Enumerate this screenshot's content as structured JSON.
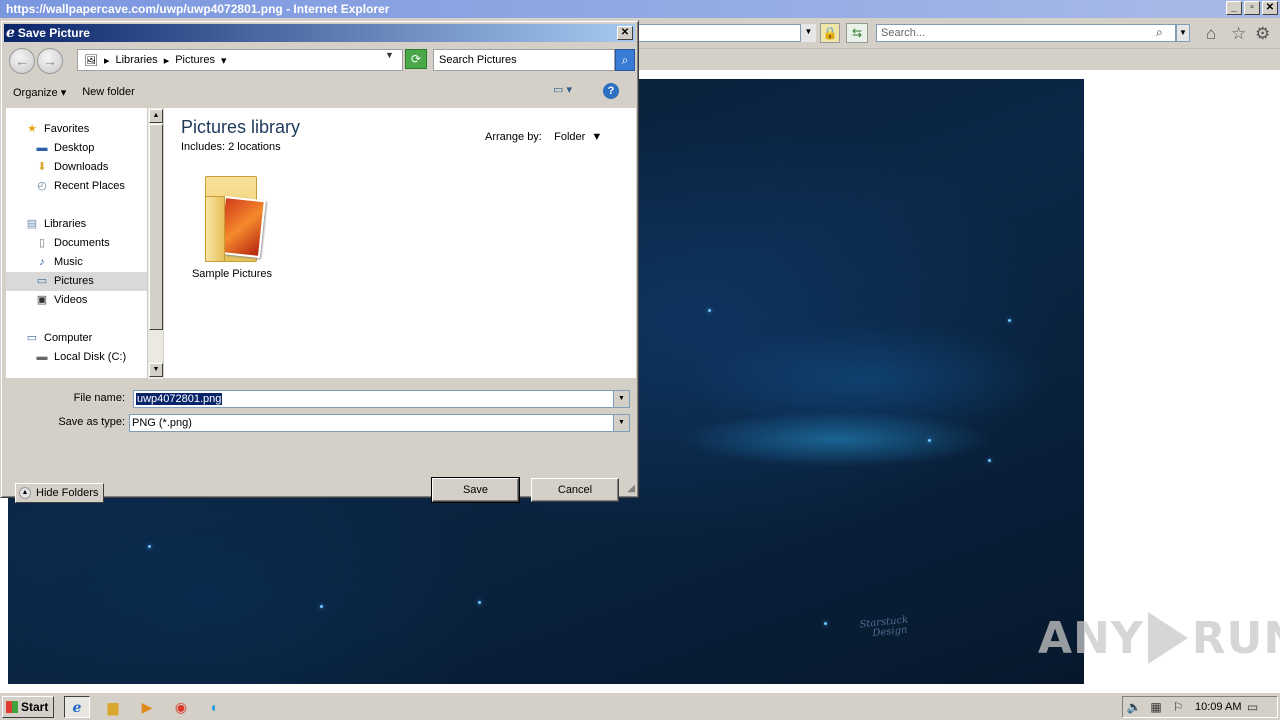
{
  "ie": {
    "window_title": "https://wallpapercave.com/uwp/uwp4072801.png - Internet Explorer",
    "search_placeholder": "Search...",
    "win_minimize": "_",
    "win_restore": "▫",
    "win_close": "✕"
  },
  "wallpaper": {
    "signature_line1": "Starstuck",
    "signature_line2": "Design"
  },
  "watermark": {
    "left": "ANY",
    "right": "RUN"
  },
  "dialog": {
    "title": "Save Picture",
    "close": "✕",
    "breadcrumb": [
      "Libraries",
      "Pictures"
    ],
    "search_placeholder": "Search Pictures",
    "commands": {
      "organize": "Organize",
      "new_folder": "New folder"
    },
    "help": "?",
    "nav_tree": [
      {
        "label": "Favorites",
        "icon": "star-icon",
        "level": 0
      },
      {
        "label": "Desktop",
        "icon": "desktop-icon",
        "level": 1
      },
      {
        "label": "Downloads",
        "icon": "downloads-icon",
        "level": 1
      },
      {
        "label": "Recent Places",
        "icon": "recent-places-icon",
        "level": 1
      },
      {
        "label": "Libraries",
        "icon": "libraries-icon",
        "level": 0
      },
      {
        "label": "Documents",
        "icon": "documents-icon",
        "level": 1
      },
      {
        "label": "Music",
        "icon": "music-icon",
        "level": 1
      },
      {
        "label": "Pictures",
        "icon": "pictures-icon",
        "level": 1,
        "selected": true
      },
      {
        "label": "Videos",
        "icon": "videos-icon",
        "level": 1
      },
      {
        "label": "Computer",
        "icon": "computer-icon",
        "level": 0
      },
      {
        "label": "Local Disk (C:)",
        "icon": "disk-icon",
        "level": 1
      }
    ],
    "library_title": "Pictures library",
    "library_includes": "Includes:  2 locations",
    "arrange_by_label": "Arrange by:",
    "arrange_by_value": "Folder",
    "items": [
      {
        "label": "Sample Pictures",
        "icon": "pictures-folder-icon"
      }
    ],
    "file_name_label": "File name:",
    "file_name_value": "uwp4072801.png",
    "save_as_type_label": "Save as type:",
    "save_as_type_value": "PNG (*.png)",
    "save_button": "Save",
    "cancel_button": "Cancel",
    "hide_folders": "Hide Folders"
  },
  "taskbar": {
    "start_label": "Start",
    "clock": "10:09 AM"
  }
}
